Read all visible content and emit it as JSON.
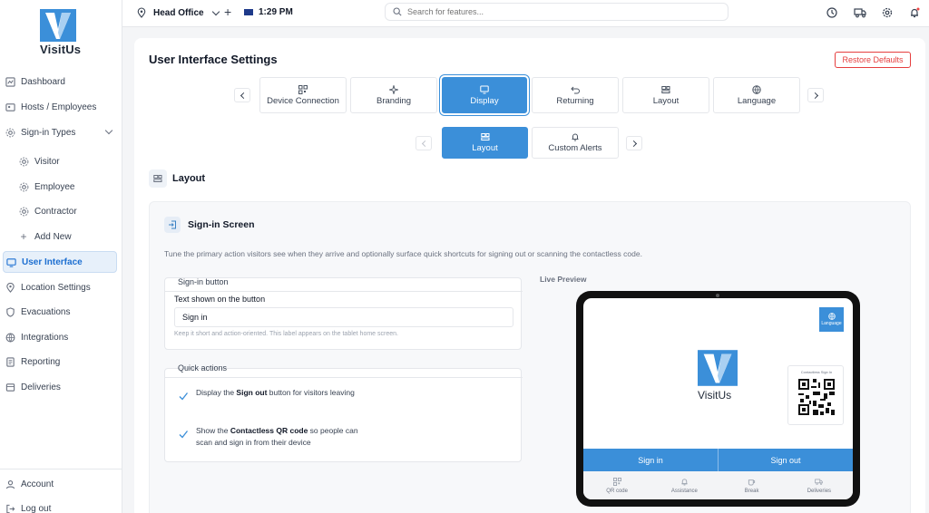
{
  "brand": {
    "name": "VisitUs",
    "color": "#3b8fd9"
  },
  "sidebar": {
    "items": [
      {
        "label": "Dashboard",
        "icon": "dashboard-icon"
      },
      {
        "label": "Hosts / Employees",
        "icon": "people-icon"
      },
      {
        "label": "Sign-in Types",
        "icon": "signin-types-icon"
      },
      {
        "label": "Visitor",
        "icon": "visitor-icon"
      },
      {
        "label": "Employee",
        "icon": "employee-icon"
      },
      {
        "label": "Contractor",
        "icon": "contractor-icon"
      },
      {
        "label": "Add New",
        "icon": "plus-icon"
      },
      {
        "label": "User Interface",
        "icon": "monitor-icon"
      },
      {
        "label": "Location Settings",
        "icon": "location-pin-icon"
      },
      {
        "label": "Evacuations",
        "icon": "shield-icon"
      },
      {
        "label": "Integrations",
        "icon": "globe-icon"
      },
      {
        "label": "Reporting",
        "icon": "report-icon"
      },
      {
        "label": "Deliveries",
        "icon": "package-icon"
      }
    ],
    "footer": [
      {
        "label": "Account",
        "icon": "user-icon"
      },
      {
        "label": "Log out",
        "icon": "logout-icon"
      }
    ]
  },
  "topbar": {
    "location": "Head Office",
    "time": "1:29 PM",
    "search_placeholder": "Search for features..."
  },
  "page": {
    "title": "User Interface Settings",
    "restore_label": "Restore Defaults",
    "tabs": [
      {
        "label": "Device Connection",
        "icon": "qr-grid-icon"
      },
      {
        "label": "Branding",
        "icon": "sparkle-icon"
      },
      {
        "label": "Display",
        "icon": "monitor-icon"
      },
      {
        "label": "Returning",
        "icon": "return-arrow-icon"
      },
      {
        "label": "Layout",
        "icon": "layout-icon"
      },
      {
        "label": "Language",
        "icon": "globe-icon"
      }
    ],
    "subtabs": [
      {
        "label": "Layout",
        "icon": "layout-icon"
      },
      {
        "label": "Custom Alerts",
        "icon": "bell-icon"
      }
    ],
    "section_title": "Layout",
    "card": {
      "title": "Sign-in Screen",
      "description": "Tune the primary action visitors see when they arrive and optionally surface quick shortcuts for signing out or scanning the contactless code.",
      "signin_button": {
        "legend": "Sign-in button",
        "field_label": "Text shown on the button",
        "value": "Sign in",
        "hint": "Keep it short and action-oriented. This label appears on the tablet home screen."
      },
      "quick_actions": {
        "legend": "Quick actions",
        "items": [
          {
            "prefix": "Display the ",
            "bold": "Sign out",
            "suffix": " button for visitors leaving"
          },
          {
            "prefix": "Show the ",
            "bold": "Contactless QR code",
            "suffix": " so people can scan and sign in from their device"
          }
        ]
      },
      "preview": {
        "label": "Live Preview",
        "language_label": "Language",
        "logo_text": "VisitUs",
        "qr_caption": "Contactless Sign In",
        "sign_in": "Sign in",
        "sign_out": "Sign out",
        "footer": [
          {
            "label": "QR code",
            "icon": "qr-grid-icon"
          },
          {
            "label": "Assistance",
            "icon": "bell-icon"
          },
          {
            "label": "Break",
            "icon": "break-icon"
          },
          {
            "label": "Deliveries",
            "icon": "truck-icon"
          }
        ]
      }
    }
  }
}
